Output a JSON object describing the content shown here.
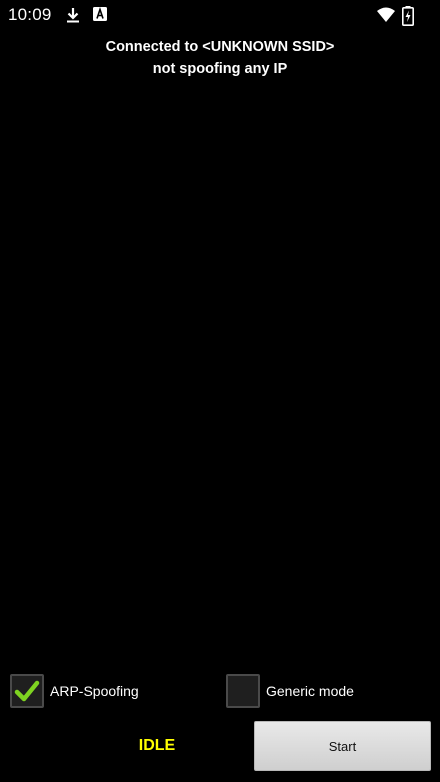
{
  "status_bar": {
    "time": "10:09",
    "icons": [
      "download-icon",
      "a-notification-icon",
      "wifi-icon",
      "battery-charging-icon"
    ]
  },
  "info": {
    "connection": "Connected to <UNKNOWN SSID>",
    "spoof_status": "not spoofing any IP"
  },
  "controls": {
    "arp_spoofing": {
      "label": "ARP-Spoofing",
      "checked": true
    },
    "generic_mode": {
      "label": "Generic mode",
      "checked": false
    },
    "state": "IDLE",
    "start_label": "Start"
  },
  "colors": {
    "background": "#000000",
    "state_text": "#ffff00",
    "checkmark": "#7ed321"
  }
}
